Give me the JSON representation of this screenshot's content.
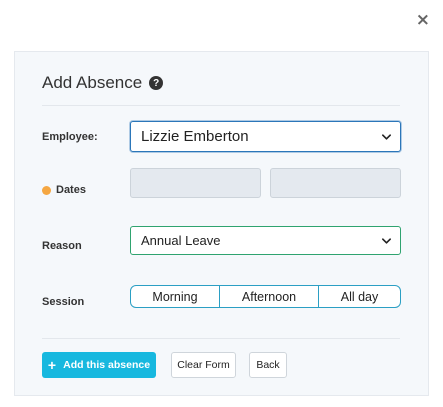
{
  "dialog": {
    "close_glyph": "×",
    "title": "Add Absence",
    "help_glyph": "?"
  },
  "form": {
    "employee": {
      "label": "Employee:",
      "value": "Lizzie Emberton"
    },
    "dates": {
      "label": "Dates",
      "start_value": "",
      "end_value": ""
    },
    "reason": {
      "label": "Reason",
      "value": "Annual Leave"
    },
    "session": {
      "label": "Session",
      "options": [
        "Morning",
        "Afternoon",
        "All day"
      ]
    }
  },
  "actions": {
    "add_plus": "+",
    "add_label": "Add this absence",
    "clear_label": "Clear Form",
    "back_label": "Back"
  },
  "colors": {
    "required_dot": "#f5a742",
    "add_button": "#17b8df",
    "employee_focus_border": "#2b76b9",
    "reason_border": "#2fa36f",
    "session_border": "#2b9fc4"
  },
  "icons": {
    "close": "close-icon",
    "help": "help-icon",
    "dropdown": "chevron-down-icon",
    "add": "plus-icon"
  }
}
